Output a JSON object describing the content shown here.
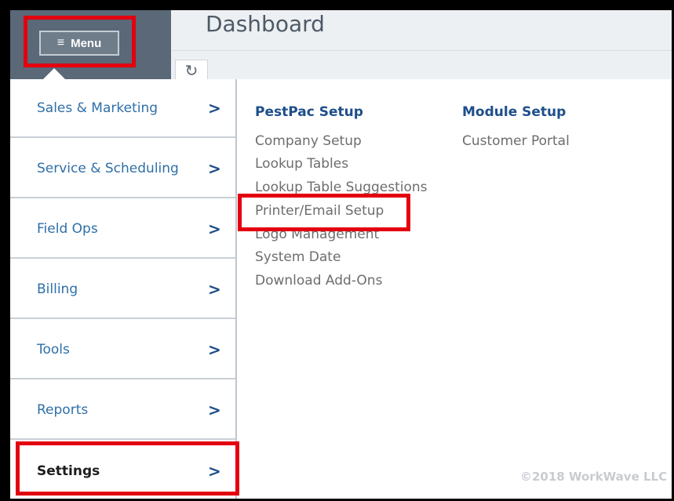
{
  "header": {
    "title": "Dashboard",
    "menu_button_label": "Menu",
    "menu_icon": "hamburger-icon",
    "refresh_icon": "refresh-icon"
  },
  "sidebar": {
    "items": [
      {
        "label": "Sales & Marketing",
        "chevron": ">"
      },
      {
        "label": "Service & Scheduling",
        "chevron": ">"
      },
      {
        "label": "Field Ops",
        "chevron": ">"
      },
      {
        "label": "Billing",
        "chevron": ">"
      },
      {
        "label": "Tools",
        "chevron": ">"
      },
      {
        "label": "Reports",
        "chevron": ">"
      },
      {
        "label": "Settings",
        "chevron": ">"
      }
    ],
    "active_item": "Settings"
  },
  "content": {
    "pestpac_setup": {
      "heading": "PestPac Setup",
      "links": [
        "Company Setup",
        "Lookup Tables",
        "Lookup Table Suggestions",
        "Printer/Email Setup",
        "Logo Management",
        "System Date",
        "Download Add-Ons"
      ]
    },
    "module_setup": {
      "heading": "Module Setup",
      "links": [
        "Customer Portal"
      ]
    }
  },
  "footer": {
    "copyright": "©2018 WorkWave LLC"
  },
  "colors": {
    "highlight": "#e3000f",
    "link_blue": "#2e6fa8",
    "heading_blue": "#1d4e8a",
    "menu_panel": "#5a6877"
  }
}
